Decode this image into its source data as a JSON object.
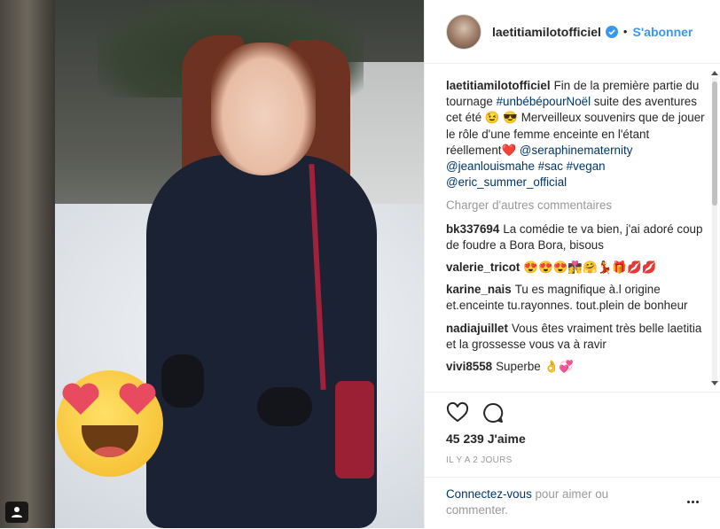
{
  "post": {
    "username": "laetitiamilotofficiel",
    "follow_label": "S'abonner",
    "separator": "•",
    "caption": {
      "user": "laetitiamilotofficiel",
      "before_tag": "Fin de la première partie du tournage ",
      "hashtag": "#unbébépourNoël",
      "middle": " suite des aventures cet été 😉 😎 Merveilleux souvenirs que de jouer le rôle d'une femme enceinte en l'étant réellement❤️ ",
      "mentions": "@seraphinematernity @jeanlouismahe #sac #vegan @eric_summer_official"
    },
    "load_more": "Charger d'autres commentaires",
    "comments": [
      {
        "user": "bk337694",
        "text": "La comédie te va bien, j'ai adoré coup de foudre a Bora Bora, bisous"
      },
      {
        "user": "valerie_tricot",
        "text": "😍😍😍👩‍❤️‍💋‍👨🤗💃🎁💋💋"
      },
      {
        "user": "karine_nais",
        "text": "Tu es magnifique à.l origine et.enceinte tu.rayonnes. tout.plein de bonheur"
      },
      {
        "user": "nadiajuillet",
        "text": "Vous êtes vraiment très belle laetitia et la grossesse vous va à ravir"
      },
      {
        "user": "vivi8558",
        "text": "Superbe 👌💞"
      }
    ],
    "likes": "45 239 J'aime",
    "timestamp": "IL Y A 2 JOURS",
    "login_link": "Connectez-vous",
    "login_rest": " pour aimer ou commenter."
  },
  "icons": [
    "heart-icon",
    "comment-icon",
    "verified-badge-icon",
    "more-options-icon",
    "user-tag-icon",
    "heart-eyes-emoji"
  ]
}
